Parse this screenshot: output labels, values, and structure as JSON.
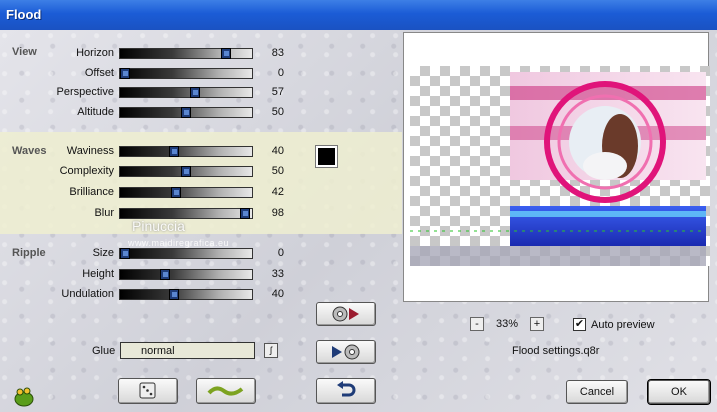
{
  "window": {
    "title": "Flood"
  },
  "sections": {
    "view": "View",
    "waves": "Waves",
    "ripple": "Ripple"
  },
  "sliders": [
    {
      "label": "Horizon",
      "value": "83",
      "level": 0.83
    },
    {
      "label": "Offset",
      "value": "0",
      "level": 0.0
    },
    {
      "label": "Perspective",
      "value": "57",
      "level": 0.57
    },
    {
      "label": "Altitude",
      "value": "50",
      "level": 0.5
    },
    {
      "label": "Waviness",
      "value": "40",
      "level": 0.4
    },
    {
      "label": "Complexity",
      "value": "50",
      "level": 0.5
    },
    {
      "label": "Brilliance",
      "value": "42",
      "level": 0.42
    },
    {
      "label": "Blur",
      "value": "98",
      "level": 0.98
    },
    {
      "label": "Size",
      "value": "0",
      "level": 0.0
    },
    {
      "label": "Height",
      "value": "33",
      "level": 0.33
    },
    {
      "label": "Undulation",
      "value": "40",
      "level": 0.4
    }
  ],
  "waves_color": "#000000",
  "glue": {
    "label": "Glue",
    "value": "normal"
  },
  "watermark": {
    "line1": "Pinuccia",
    "line2": "www.maidiregrafica.eu"
  },
  "preview": {
    "zoom": "33%",
    "zoom_minus": "-",
    "zoom_plus": "+",
    "auto_preview_label": "Auto preview",
    "auto_preview_checked": true,
    "settings_file": "Flood settings.q8r"
  },
  "buttons": {
    "cancel": "Cancel",
    "ok": "OK"
  },
  "icons": {
    "load_preset": "load-preset-icon",
    "save_preset": "save-preset-icon",
    "undo": "undo-icon",
    "random": "dice-icon",
    "reset": "wave-icon",
    "logo": "frog-logo-icon"
  }
}
